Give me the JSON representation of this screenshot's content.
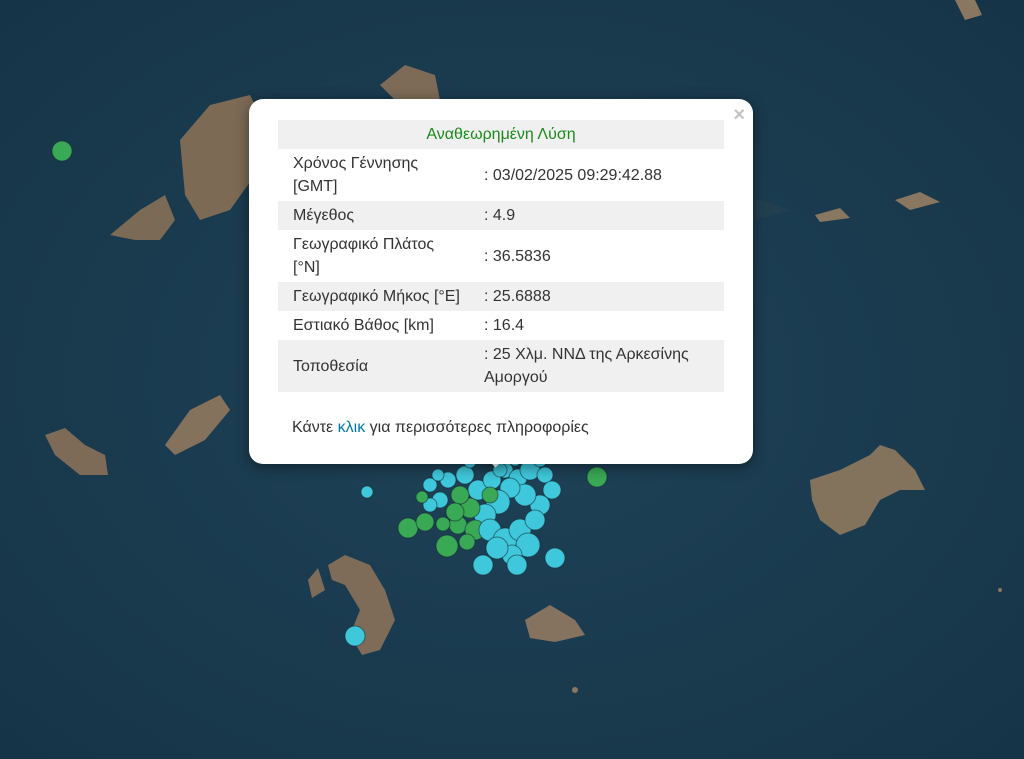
{
  "popup": {
    "header": "Αναθεωρημένη Λύση",
    "rows": [
      {
        "label": "Χρόνος Γέννησης [GMT]",
        "value": ": 03/02/2025 09:29:42.88"
      },
      {
        "label": "Μέγεθος",
        "value": ": 4.9"
      },
      {
        "label": "Γεωγραφικό Πλάτος [°N]",
        "value": ": 36.5836"
      },
      {
        "label": "Γεωγραφικό Μήκος [°E]",
        "value": ": 25.6888"
      },
      {
        "label": "Εστιακό Βάθος [km]",
        "value": ": 16.4"
      },
      {
        "label": "Τοποθεσία",
        "value": ": 25 Χλμ. ΝΝΔ της Αρκεσίνης Αμοργού"
      }
    ],
    "more_prefix": "Κάντε",
    "more_link": "κλικ",
    "more_suffix": "για περισσότερες πληροφορίες",
    "close_label": "×"
  },
  "map": {
    "colors": {
      "sea": "#1a3a4e",
      "land": "#8a7560",
      "marker_cyan": "#3fc8dc",
      "marker_green": "#3aa955"
    }
  }
}
